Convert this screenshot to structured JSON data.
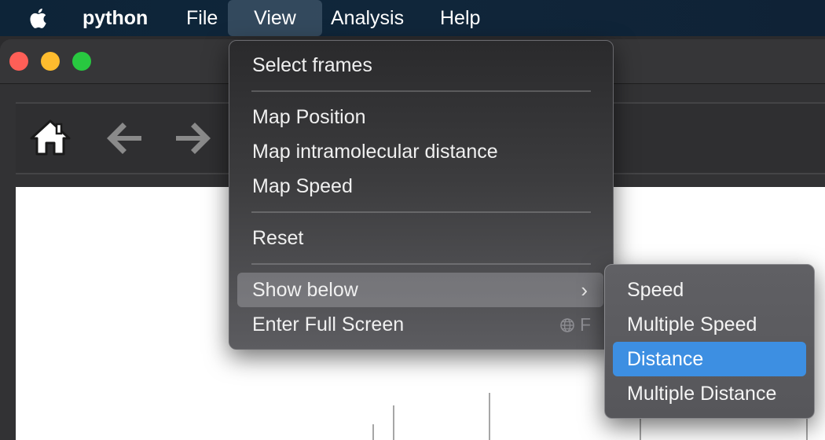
{
  "menubar": {
    "apple_icon": "apple-logo-icon",
    "app_name": "python",
    "items": [
      "File",
      "View",
      "Analysis",
      "Help"
    ],
    "active_item": "View"
  },
  "window": {
    "traffic_lights": {
      "close": "#fe5f57",
      "minimize": "#febc2e",
      "zoom": "#28c840"
    },
    "toolbar_icons": [
      "home-icon",
      "back-arrow-icon",
      "forward-arrow-icon"
    ]
  },
  "view_menu": {
    "items": [
      {
        "label": "Select frames"
      },
      {
        "label": "Map Position"
      },
      {
        "label": "Map intramolecular distance"
      },
      {
        "label": "Map Speed"
      },
      {
        "label": "Reset"
      },
      {
        "label": "Show below",
        "has_submenu": true,
        "highlighted": true
      },
      {
        "label": "Enter Full Screen",
        "shortcut": "F",
        "shortcut_icon": "globe-icon"
      }
    ]
  },
  "show_below_submenu": {
    "items": [
      "Speed",
      "Multiple Speed",
      "Distance",
      "Multiple Distance"
    ],
    "selected": "Distance",
    "selected_color": "#3d8fe2"
  }
}
